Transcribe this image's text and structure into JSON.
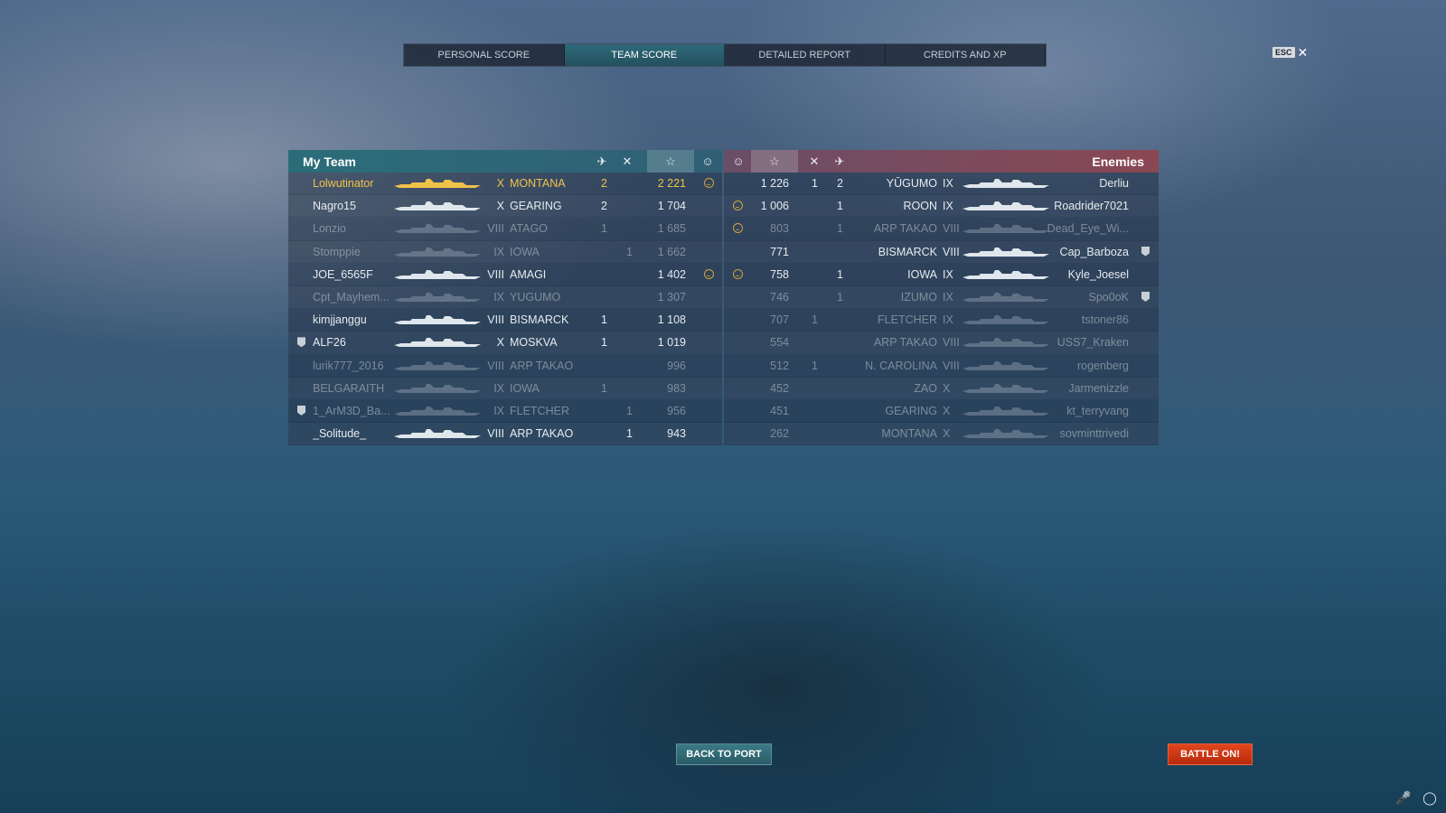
{
  "tabs": [
    "PERSONAL SCORE",
    "TEAM SCORE",
    "DETAILED REPORT",
    "CREDITS AND XP"
  ],
  "active_tab": 1,
  "esc_label": "ESC",
  "my_team": {
    "title": "My Team",
    "rows": [
      {
        "player": "Lolwutinator",
        "tier": "X",
        "ship": "MONTANA",
        "planes": "2",
        "fires": "",
        "score": "2 221",
        "smile": true,
        "state": "me",
        "badge": false
      },
      {
        "player": "Nagro15",
        "tier": "X",
        "ship": "GEARING",
        "planes": "2",
        "fires": "",
        "score": "1 704",
        "smile": false,
        "state": "alive",
        "badge": false
      },
      {
        "player": "Lonzio",
        "tier": "VIII",
        "ship": "ATAGO",
        "planes": "1",
        "fires": "",
        "score": "1 685",
        "smile": false,
        "state": "dead",
        "badge": false
      },
      {
        "player": "Stomppie",
        "tier": "IX",
        "ship": "IOWA",
        "planes": "",
        "fires": "1",
        "score": "1 662",
        "smile": false,
        "state": "dead",
        "badge": false
      },
      {
        "player": "JOE_6565F",
        "tier": "VIII",
        "ship": "AMAGI",
        "planes": "",
        "fires": "",
        "score": "1 402",
        "smile": true,
        "state": "alive",
        "badge": false
      },
      {
        "player": "Cpt_Mayhem...",
        "tier": "IX",
        "ship": "YUGUMO",
        "planes": "",
        "fires": "",
        "score": "1 307",
        "smile": false,
        "state": "dead",
        "badge": false
      },
      {
        "player": "kimjjanggu",
        "tier": "VIII",
        "ship": "BISMARCK",
        "planes": "1",
        "fires": "",
        "score": "1 108",
        "smile": false,
        "state": "alive",
        "badge": false
      },
      {
        "player": "ALF26",
        "tier": "X",
        "ship": "MOSKVA",
        "planes": "1",
        "fires": "",
        "score": "1 019",
        "smile": false,
        "state": "alive",
        "badge": true
      },
      {
        "player": "lurik777_2016",
        "tier": "VIII",
        "ship": "ARP TAKAO",
        "planes": "",
        "fires": "",
        "score": "996",
        "smile": false,
        "state": "dead",
        "badge": false
      },
      {
        "player": "BELGARAITH",
        "tier": "IX",
        "ship": "IOWA",
        "planes": "1",
        "fires": "",
        "score": "983",
        "smile": false,
        "state": "dead",
        "badge": false
      },
      {
        "player": "1_ArM3D_Ba...",
        "tier": "IX",
        "ship": "FLETCHER",
        "planes": "",
        "fires": "1",
        "score": "956",
        "smile": false,
        "state": "dead",
        "badge": true
      },
      {
        "player": "_Solitude_",
        "tier": "VIII",
        "ship": "ARP TAKAO",
        "planes": "",
        "fires": "1",
        "score": "943",
        "smile": false,
        "state": "alive",
        "badge": false
      }
    ]
  },
  "enemies": {
    "title": "Enemies",
    "rows": [
      {
        "player": "Derliu",
        "tier": "IX",
        "ship": "YŪGUMO",
        "planes": "2",
        "fires": "1",
        "score": "1 226",
        "smile": false,
        "state": "alive",
        "badge": false
      },
      {
        "player": "Roadrider7021",
        "tier": "IX",
        "ship": "ROON",
        "planes": "1",
        "fires": "",
        "score": "1 006",
        "smile": true,
        "state": "alive",
        "badge": false
      },
      {
        "player": "Dead_Eye_Wi...",
        "tier": "VIII",
        "ship": "ARP TAKAO",
        "planes": "1",
        "fires": "",
        "score": "803",
        "smile": true,
        "state": "dead",
        "badge": false
      },
      {
        "player": "Cap_Barboza",
        "tier": "VIII",
        "ship": "BISMARCK",
        "planes": "",
        "fires": "",
        "score": "771",
        "smile": false,
        "state": "alive",
        "badge": true
      },
      {
        "player": "Kyle_Joesel",
        "tier": "IX",
        "ship": "IOWA",
        "planes": "1",
        "fires": "",
        "score": "758",
        "smile": true,
        "state": "alive",
        "badge": false
      },
      {
        "player": "Spo0oK",
        "tier": "IX",
        "ship": "IZUMO",
        "planes": "1",
        "fires": "",
        "score": "746",
        "smile": false,
        "state": "dead",
        "badge": true
      },
      {
        "player": "tstoner86",
        "tier": "IX",
        "ship": "FLETCHER",
        "planes": "",
        "fires": "1",
        "score": "707",
        "smile": false,
        "state": "dead",
        "badge": false
      },
      {
        "player": "USS7_Kraken",
        "tier": "VIII",
        "ship": "ARP TAKAO",
        "planes": "",
        "fires": "",
        "score": "554",
        "smile": false,
        "state": "dead",
        "badge": false
      },
      {
        "player": "rogenberg",
        "tier": "VIII",
        "ship": "N. CAROLINA",
        "planes": "",
        "fires": "1",
        "score": "512",
        "smile": false,
        "state": "dead",
        "badge": false
      },
      {
        "player": "Jarmenizzle",
        "tier": "X",
        "ship": "ZAO",
        "planes": "",
        "fires": "",
        "score": "452",
        "smile": false,
        "state": "dead",
        "badge": false
      },
      {
        "player": "kt_terryvang",
        "tier": "X",
        "ship": "GEARING",
        "planes": "",
        "fires": "",
        "score": "451",
        "smile": false,
        "state": "dead",
        "badge": false
      },
      {
        "player": "sovminttrivedi",
        "tier": "X",
        "ship": "MONTANA",
        "planes": "",
        "fires": "",
        "score": "262",
        "smile": false,
        "state": "dead",
        "badge": false
      }
    ]
  },
  "buttons": {
    "back": "BACK TO PORT",
    "battle": "BATTLE ON!"
  },
  "icons": {
    "planes": "plane-icon",
    "fires": "crossed-swords-icon",
    "score": "star-icon",
    "smile": "smile-icon"
  },
  "colors": {
    "my_team_header": "#266c76",
    "enemy_header": "#8c4650",
    "highlight": "#f0c24a",
    "battle_button": "#d43a16"
  }
}
